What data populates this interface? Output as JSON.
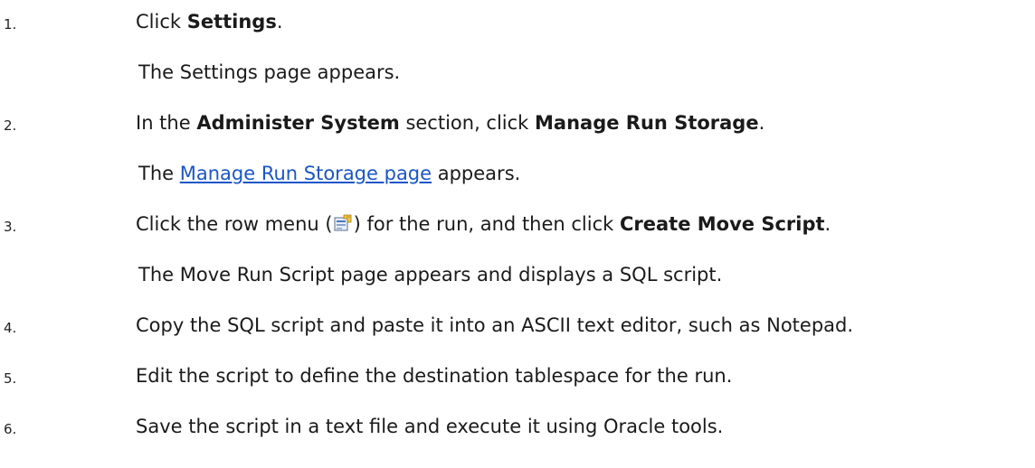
{
  "steps": [
    {
      "number": "1.",
      "parts": [
        "Click ",
        "Settings",
        "."
      ],
      "result": "The Settings page appears."
    },
    {
      "number": "2.",
      "parts": [
        "In the ",
        "Administer System",
        " section, click ",
        "Manage Run Storage",
        "."
      ],
      "result_parts": [
        "The ",
        "Manage Run Storage page",
        " appears."
      ]
    },
    {
      "number": "3.",
      "parts": [
        "Click the row menu (",
        ") for the run, and then click ",
        "Create Move Script",
        "."
      ],
      "icon": "row-menu-icon",
      "result": "The Move Run Script page appears and displays a SQL script."
    },
    {
      "number": "4.",
      "text": "Copy the SQL script and paste it into an ASCII text editor, such as Notepad."
    },
    {
      "number": "5.",
      "text": "Edit the script to define the destination tablespace for the run."
    },
    {
      "number": "6.",
      "text": "Save the script in a text file and execute it using Oracle tools."
    }
  ]
}
